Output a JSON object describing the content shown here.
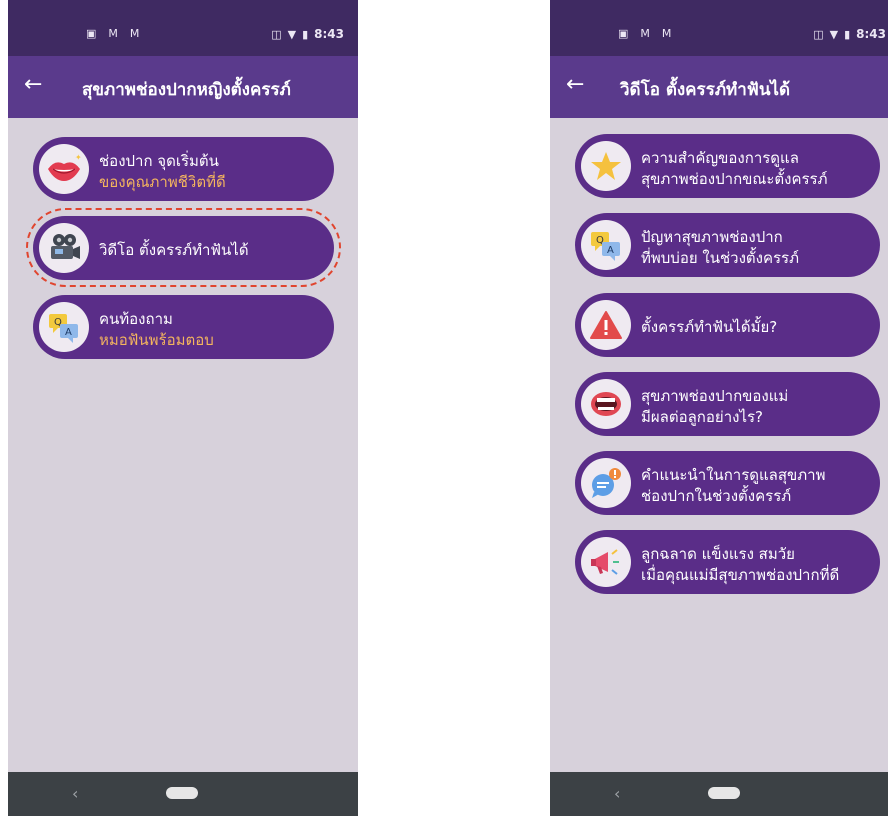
{
  "status_bar": {
    "time": "8:43",
    "left_icons": [
      "sim-card-icon",
      "gmail-icon",
      "gmail-icon"
    ],
    "right_icons": [
      "vibrate-icon",
      "wifi-icon",
      "battery-icon"
    ]
  },
  "left_screen": {
    "title": "สุขภาพช่องปากหญิงตั้งครรภ์",
    "items": [
      {
        "icon": "lips-icon",
        "line1": "ช่องปาก จุดเริ่มต้น",
        "line2": "ของคุณภาพชีวิตที่ดี"
      },
      {
        "icon": "video-camera-icon",
        "line1": "วิดีโอ ตั้งครรภ์ทำฟันได้"
      },
      {
        "icon": "qa-chat-icon",
        "line1": "คนท้องถาม",
        "line2": "หมอฟันพร้อมตอบ"
      }
    ]
  },
  "right_screen": {
    "title": "วิดีโอ ตั้งครรภ์ทำฟันได้",
    "items": [
      {
        "icon": "star-icon",
        "line1": "ความสำคัญของการดูแล",
        "line2": "สุขภาพช่องปากขณะตั้งครรภ์"
      },
      {
        "icon": "qa-chat-icon",
        "line1": "ปัญหาสุขภาพช่องปาก",
        "line2": "ที่พบบ่อย ในช่วงตั้งครรภ์"
      },
      {
        "icon": "warning-icon",
        "line1": "ตั้งครรภ์ทำฟันได้มั้ย?"
      },
      {
        "icon": "open-mouth-icon",
        "line1": "สุขภาพช่องปากของแม่",
        "line2": "มีผลต่อลูกอย่างไร?"
      },
      {
        "icon": "speech-bubble-icon",
        "line1": "คำแนะนำในการดูแลสุขภาพ",
        "line2": "ช่องปากในช่วงตั้งครรภ์"
      },
      {
        "icon": "megaphone-icon",
        "line1": "ลูกฉลาด แข็งแรง สมวัย",
        "line2": "เมื่อคุณแม่มีสุขภาพช่องปากที่ดี"
      }
    ]
  },
  "colors": {
    "status_bar": "#3f2a62",
    "app_bar": "#5a3a8c",
    "pill": "#5a2d88",
    "accent_text": "#f4b55e",
    "background": "#d7d1db",
    "highlight": "#e0452f",
    "nav_bar": "#3c4145"
  }
}
